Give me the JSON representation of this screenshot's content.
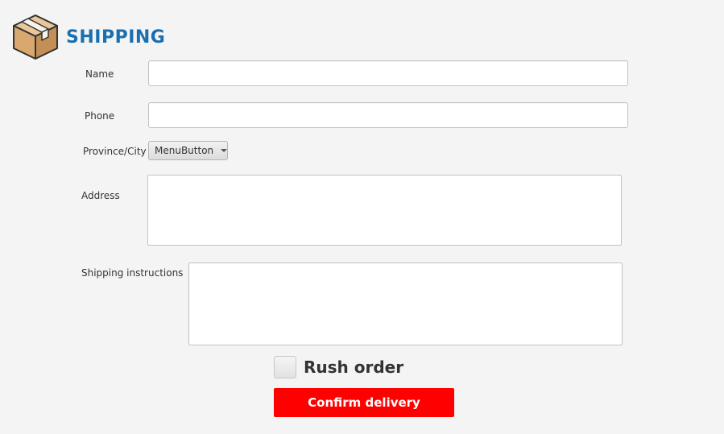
{
  "header": {
    "icon": "package-box-icon",
    "title": "SHIPPING"
  },
  "form": {
    "name_label": "Name",
    "name_value": "",
    "phone_label": "Phone",
    "phone_value": "",
    "province_label": "Province/City",
    "province_button_label": "MenuButton",
    "address_label": "Address",
    "address_value": "",
    "instructions_label": "Shipping instructions",
    "instructions_value": "",
    "rush_order_label": "Rush order",
    "rush_order_checked": false,
    "confirm_label": "Confirm delivery"
  },
  "colors": {
    "title": "#1a6fb0",
    "confirm_bg": "#ff0000",
    "background": "#f4f4f4"
  }
}
